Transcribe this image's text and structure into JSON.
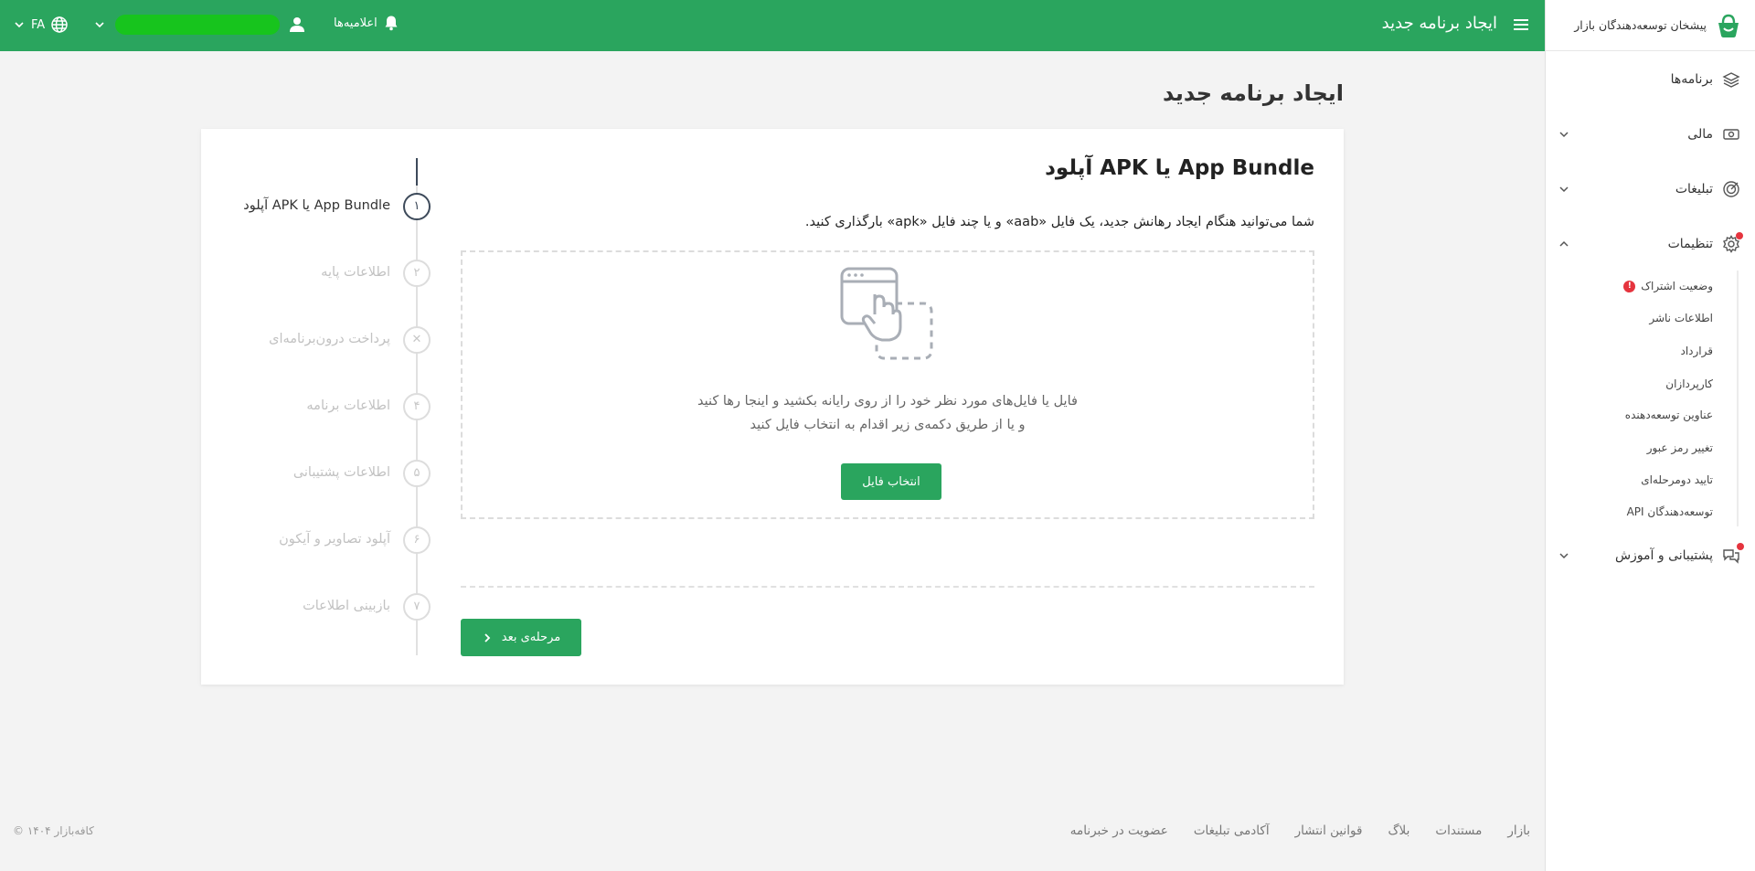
{
  "sidebar": {
    "brand": "پیشخان توسعه‌دهندگان بازار",
    "items": [
      {
        "label": "برنامه‌ها"
      },
      {
        "label": "مالی"
      },
      {
        "label": "تبلیغات"
      },
      {
        "label": "تنظیمات"
      },
      {
        "label": "پشتیبانی و آموزش"
      }
    ],
    "settings_sub": [
      {
        "label": "وضعیت اشتراک",
        "alert": "!"
      },
      {
        "label": "اطلاعات ناشر"
      },
      {
        "label": "قرارداد"
      },
      {
        "label": "کارپردازان"
      },
      {
        "label": "عناوین توسعه‌دهنده"
      },
      {
        "label": "تغییر رمز عبور"
      },
      {
        "label": "تایید دومرحله‌ای"
      },
      {
        "label": "API توسعه‌دهندگان"
      }
    ]
  },
  "topbar": {
    "title": "ایجاد برنامه جدید",
    "announcements": "اعلامیه‌ها",
    "language": "FA"
  },
  "page": {
    "title": "ایجاد برنامه جدید"
  },
  "steps": [
    {
      "number": "۱",
      "label": "آپلود APK یا App Bundle",
      "active": true
    },
    {
      "number": "۲",
      "label": "اطلاعات پایه"
    },
    {
      "number": "✕",
      "label": "پرداخت درون‌برنامه‌ای"
    },
    {
      "number": "۴",
      "label": "اطلاعات برنامه"
    },
    {
      "number": "۵",
      "label": "اطلاعات پشتیبانی"
    },
    {
      "number": "۶",
      "label": "آپلود تصاویر و آیکون"
    },
    {
      "number": "۷",
      "label": "بازبینی اطلاعات"
    }
  ],
  "content": {
    "title": "آپلود APK یا App Bundle",
    "description": "شما می‌توانید هنگام ایجاد رهانش جدید، یک فایل «aab» و یا چند فایل «apk» بارگذاری کنید.",
    "dropzone_line1": "فایل یا فایل‌های مورد نظر خود را از روی رایانه بکشید و اینجا رها کنید",
    "dropzone_line2": "و یا از طریق دکمه‌ی زیر اقدام به انتخاب فایل کنید",
    "select_file_button": "انتخاب فایل",
    "next_button": "مرحله‌ی بعد"
  },
  "footer": {
    "links": [
      "بازار",
      "مستندات",
      "بلاگ",
      "قوانین انتشار",
      "آکادمی تبلیغات",
      "عضویت در خبرنامه"
    ],
    "copyright": "© ۱۴۰۴ کافه‌بازار"
  },
  "colors": {
    "brand_green": "#2aa55e",
    "step_active": "#3d4a5a",
    "alert_red": "#e5343e"
  }
}
